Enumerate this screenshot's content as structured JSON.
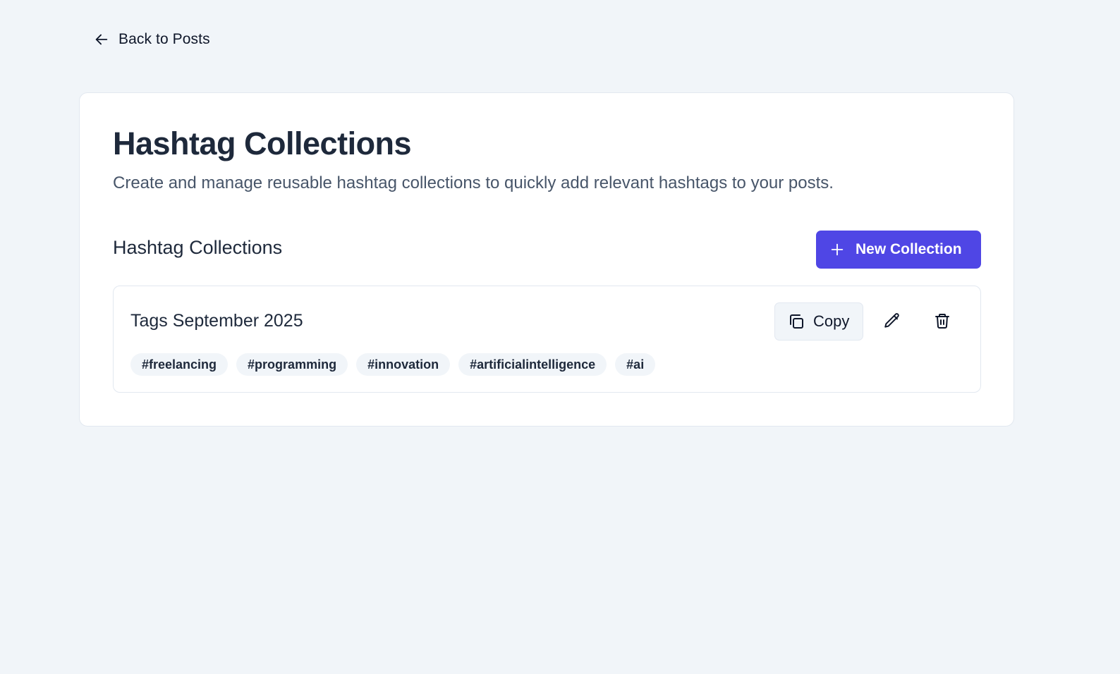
{
  "nav": {
    "back_label": "Back to Posts",
    "back_icon": "arrow-left-icon"
  },
  "header": {
    "title": "Hashtag Collections",
    "description": "Create and manage reusable hashtag collections to quickly add relevant hashtags to your posts."
  },
  "section": {
    "title": "Hashtag Collections",
    "new_button_label": "New Collection",
    "new_button_icon": "plus-icon"
  },
  "collections": [
    {
      "name": "Tags September 2025",
      "copy_label": "Copy",
      "tags": [
        "#freelancing",
        "#programming",
        "#innovation",
        "#artificialintelligence",
        "#ai"
      ]
    }
  ],
  "colors": {
    "accent": "#4f46e5",
    "background": "#f1f5f9",
    "text": "#1e293b",
    "muted_text": "#475569"
  }
}
